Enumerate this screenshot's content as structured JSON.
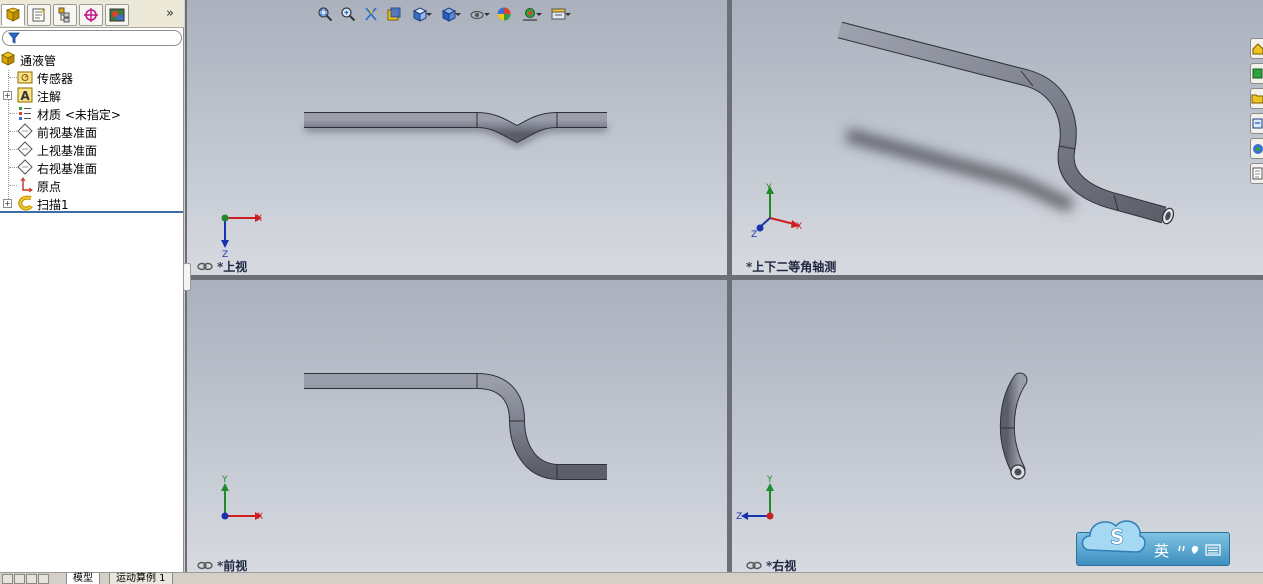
{
  "panel": {
    "more_glyph": "»",
    "tree": [
      {
        "label": "通液管",
        "icon": "part-icon",
        "level": 0,
        "expander": ""
      },
      {
        "label": "传感器",
        "icon": "sensor-folder-icon",
        "level": 1,
        "expander": ""
      },
      {
        "label": "注解",
        "icon": "annotation-icon",
        "level": 1,
        "expander": "+"
      },
      {
        "label": "材质 <未指定>",
        "icon": "material-icon",
        "level": 1,
        "expander": ""
      },
      {
        "label": "前视基准面",
        "icon": "plane-icon",
        "level": 1,
        "expander": ""
      },
      {
        "label": "上视基准面",
        "icon": "plane-icon",
        "level": 1,
        "expander": ""
      },
      {
        "label": "右视基准面",
        "icon": "plane-icon",
        "level": 1,
        "expander": ""
      },
      {
        "label": "原点",
        "icon": "origin-icon",
        "level": 1,
        "expander": ""
      },
      {
        "label": "扫描1",
        "icon": "sweep-icon",
        "level": 1,
        "expander": "+"
      }
    ]
  },
  "bottom_tabs": [
    {
      "label": "模型"
    },
    {
      "label": "运动算例 1"
    }
  ],
  "viewports": {
    "top": {
      "label": "*上视",
      "axes": [
        "X",
        "Z"
      ]
    },
    "iso": {
      "label": "*上下二等角轴测",
      "axes": [
        "Y",
        "X",
        "Z"
      ]
    },
    "front": {
      "label": "*前视",
      "axes": [
        "Y",
        "X"
      ]
    },
    "right": {
      "label": "*右视",
      "axes": [
        "Y",
        "Z"
      ]
    }
  },
  "hud_tools": [
    "zoom-to-fit-icon",
    "zoom-to-area-icon",
    "previous-view-icon",
    "section-view-icon",
    "view-orientation-icon",
    "display-style-icon",
    "hide-show-items-icon",
    "edit-appearance-icon",
    "apply-scene-icon",
    "view-settings-icon"
  ],
  "ime": {
    "letter": "S",
    "text": "英"
  },
  "colors": {
    "tube_fill": "#7b7f8d",
    "tube_edge": "#2f3138",
    "axis_x": "#cc2020",
    "axis_y": "#1f8a2a",
    "axis_z": "#1a32b0"
  }
}
